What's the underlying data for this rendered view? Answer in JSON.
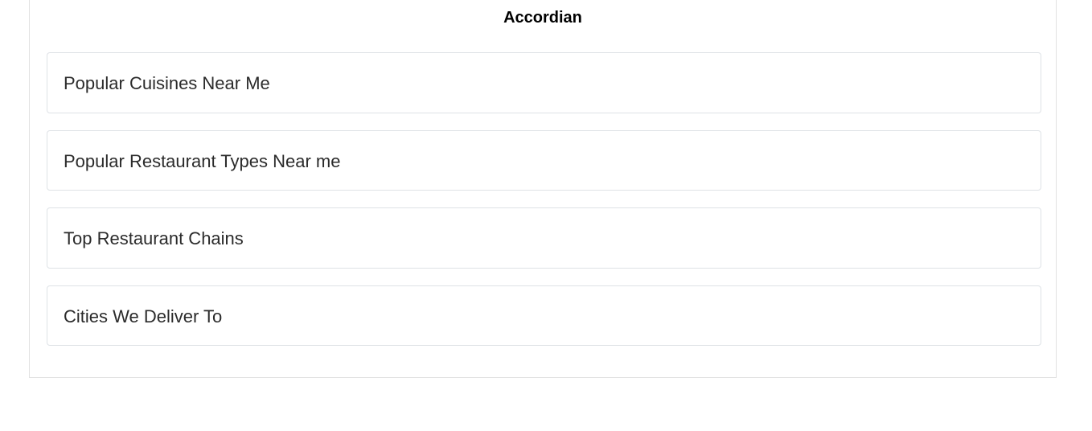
{
  "accordion": {
    "title": "Accordian",
    "items": [
      {
        "label": "Popular Cuisines Near Me"
      },
      {
        "label": "Popular Restaurant Types Near me"
      },
      {
        "label": "Top Restaurant Chains"
      },
      {
        "label": "Cities We Deliver To"
      }
    ]
  }
}
